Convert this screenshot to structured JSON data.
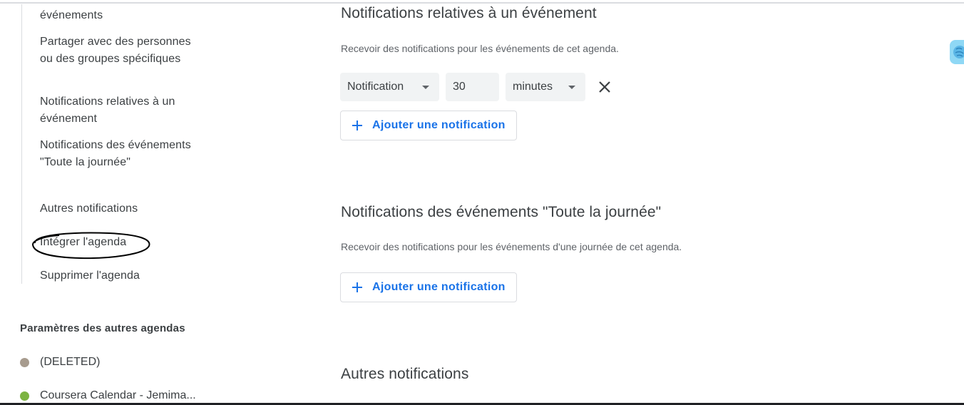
{
  "sidebar": {
    "items": [
      {
        "label": "événements"
      },
      {
        "label": "Partager avec des personnes ou des groupes spécifiques"
      },
      {
        "label": "Notifications relatives à un événement"
      },
      {
        "label": "Notifications des événements \"Toute la journée\""
      },
      {
        "label": "Autres notifications"
      },
      {
        "label": "Intégrer l'agenda"
      },
      {
        "label": "Supprimer l'agenda"
      }
    ],
    "other_calendars_header": "Paramètres des autres agendas",
    "other_calendars": [
      {
        "label": "(DELETED)",
        "color": "#a79b8e"
      },
      {
        "label": "Coursera Calendar - Jemima...",
        "color": "#7cb342"
      }
    ]
  },
  "main": {
    "event_notifications": {
      "title": "Notifications relatives à un événement",
      "description": "Recevoir des notifications pour les événements de cet agenda.",
      "type_value": "Notification",
      "amount_value": "30",
      "unit_value": "minutes",
      "add_label": "Ajouter une notification"
    },
    "allday_notifications": {
      "title": "Notifications des événements \"Toute la journée\"",
      "description": "Recevoir des notifications pour les événements d'une journée de cet agenda.",
      "add_label": "Ajouter une notification"
    },
    "other_notifications": {
      "title": "Autres notifications"
    }
  },
  "colors": {
    "accent": "#1a73e8",
    "text": "#3c4043",
    "secondary_text": "#5f6368"
  }
}
